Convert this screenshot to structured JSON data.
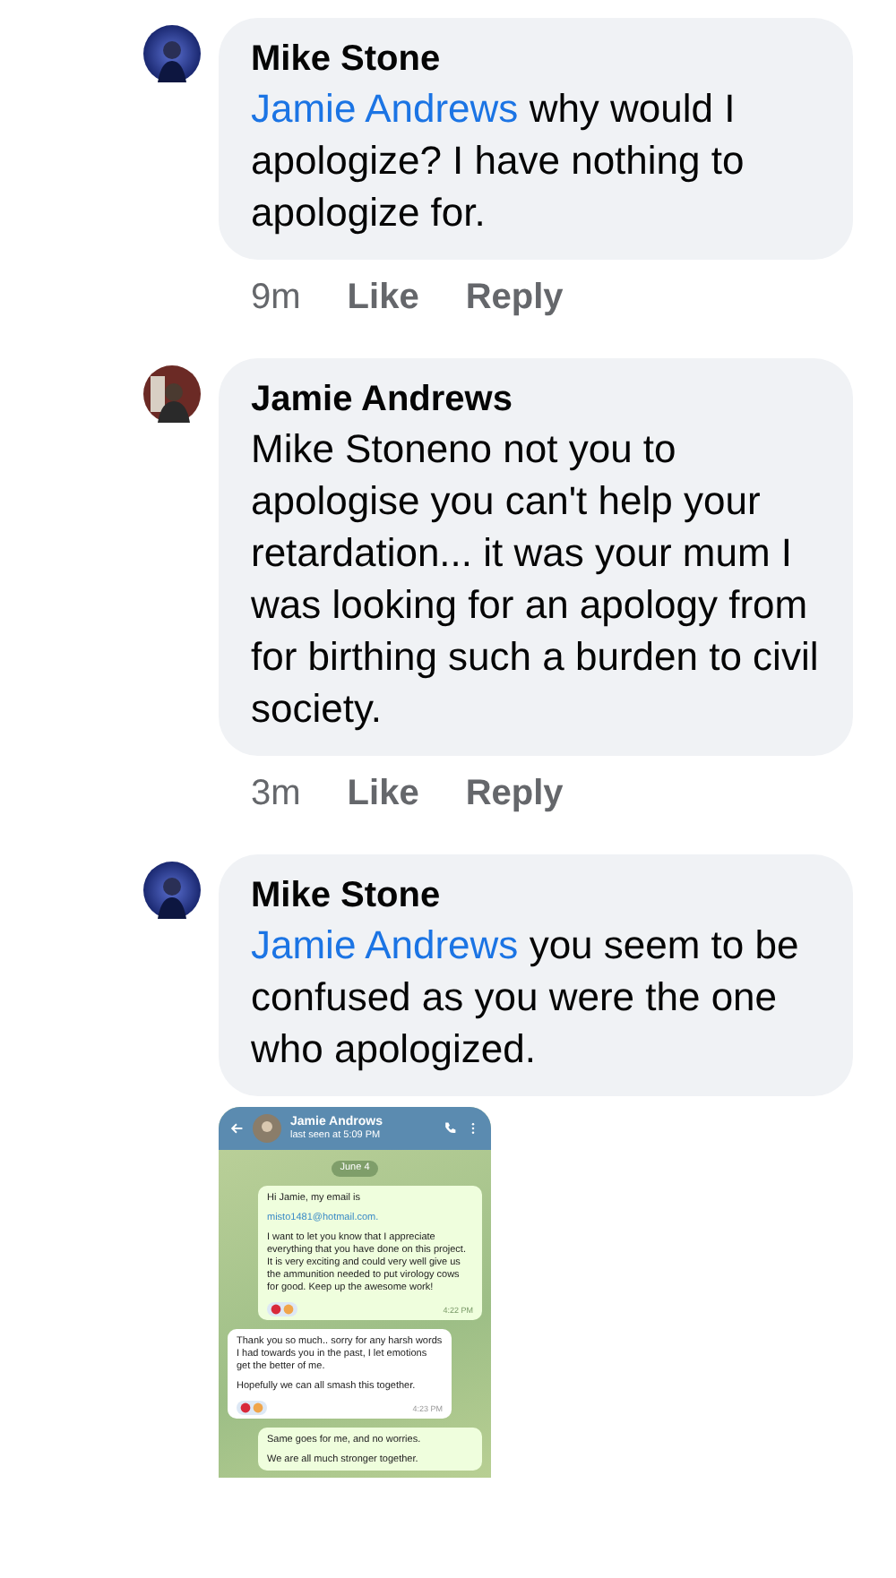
{
  "comments": [
    {
      "author": "Mike Stone",
      "avatar": {
        "kind": "blue"
      },
      "mention": "Jamie Andrews",
      "text": "why would I apologize? I have nothing to apologize for.",
      "time": "9m",
      "actions": [
        "Like",
        "Reply"
      ]
    },
    {
      "author": "Jamie Andrews",
      "avatar": {
        "kind": "dark"
      },
      "text": "Mike Stoneno not you to apologise you can't help your retardation... it was your mum I was looking for an apology from for birthing such a burden to civil society.",
      "time": "3m",
      "actions": [
        "Like",
        "Reply"
      ]
    },
    {
      "author": "Mike Stone",
      "avatar": {
        "kind": "blue"
      },
      "mention": "Jamie Andrews",
      "text": "you seem to be confused as you were the one who apologized.",
      "attachment": {
        "contact": "Jamie Androws",
        "status": "last seen at 5:09 PM",
        "date": "June 4",
        "messages": [
          {
            "kind": "outgoing",
            "parts": [
              {
                "kind": "text",
                "text": "Hi Jamie, my email is"
              },
              {
                "kind": "link",
                "text": "misto1481@hotmail.com."
              },
              {
                "kind": "text",
                "text": "I want to let you know that I appreciate everything that you have done on this project. It is very exciting and could very well give us the ammunition needed to put virology cows for good. Keep up the awesome work!"
              }
            ],
            "reactions": true,
            "time": "4:22 PM"
          },
          {
            "kind": "incoming",
            "parts": [
              {
                "kind": "text",
                "text": "Thank you so much.. sorry for any harsh words I had towards you in the past, I let emotions get the better of me."
              },
              {
                "kind": "text",
                "text": "Hopefully we can all smash this together."
              }
            ],
            "reactions": true,
            "time": "4:23 PM"
          },
          {
            "kind": "outgoing",
            "parts": [
              {
                "kind": "text",
                "text": "Same goes for me, and no worries."
              },
              {
                "kind": "text",
                "text": "We are all much stronger together."
              }
            ],
            "reactions": false
          }
        ]
      }
    }
  ]
}
